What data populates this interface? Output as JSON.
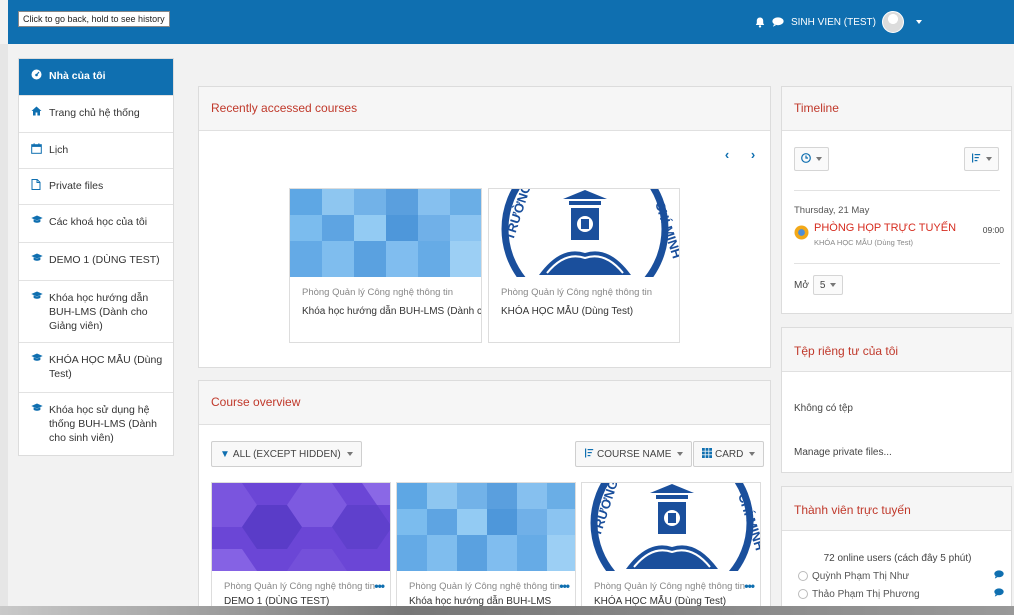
{
  "browser": {
    "tooltip": "Click to go back, hold to see history"
  },
  "navbar": {
    "user_name": "SINH VIEN (TEST)",
    "icons": [
      "bell-icon",
      "chat-icon",
      "user-avatar",
      "caret-down-icon"
    ]
  },
  "sidebar": {
    "items": [
      {
        "label": "Nhà của tôi",
        "icon": "dashboard-icon",
        "active": true
      },
      {
        "label": "Trang chủ hệ thống",
        "icon": "home-icon"
      },
      {
        "label": "Lịch",
        "icon": "calendar-icon"
      },
      {
        "label": "Private files",
        "icon": "file-icon"
      },
      {
        "label": "Các khoá học của tôi",
        "icon": "graduation-cap-icon"
      },
      {
        "label": "DEMO 1 (DÙNG TEST)",
        "icon": "graduation-cap-icon"
      },
      {
        "label": "Khóa học hướng dẫn BUH-LMS (Dành cho Giảng viên)",
        "icon": "graduation-cap-icon"
      },
      {
        "label": "KHÓA HỌC MẪU (Dùng Test)",
        "icon": "graduation-cap-icon"
      },
      {
        "label": "Khóa học sử dụng hệ thống BUH-LMS (Dành cho sinh viên)",
        "icon": "graduation-cap-icon"
      }
    ]
  },
  "recent": {
    "title": "Recently accessed courses",
    "prev": "‹",
    "next": "›",
    "courses": [
      {
        "category": "Phòng Quản lý Công nghệ thông tin",
        "name": "Khóa học hướng dẫn BUH-LMS (Dành cho Giảng viên)"
      },
      {
        "category": "Phòng Quản lý Công nghệ thông tin",
        "name": "KHÓA HỌC MẪU (Dùng Test)"
      }
    ]
  },
  "overview": {
    "title": "Course overview",
    "filter": "ALL (EXCEPT HIDDEN)",
    "sort": "COURSE NAME",
    "view": "CARD",
    "more": "•••",
    "courses": [
      {
        "category": "Phòng Quản lý Công nghệ thông tin",
        "name": "DEMO 1 (DÙNG TEST)"
      },
      {
        "category": "Phòng Quản lý Công nghệ thông tin",
        "name": "Khóa học hướng dẫn BUH-LMS"
      },
      {
        "category": "Phòng Quản lý Công nghệ thông tin",
        "name": "KHÓA HỌC MẪU (Dùng Test)"
      }
    ]
  },
  "timeline": {
    "title": "Timeline",
    "date": "Thursday, 21 May",
    "event_title": "PHÒNG HỌP TRỰC TUYẾN",
    "event_course": "KHÓA HỌC MẪU (Dùng Test)",
    "event_time": "09:00",
    "more_label": "Mở",
    "more_count": "5"
  },
  "private_files": {
    "title": "Tệp riêng tư của tôi",
    "empty": "Không có tệp",
    "manage": "Manage private files..."
  },
  "online": {
    "title": "Thành viên trực tuyến",
    "summary": "72 online users (cách đây 5 phút)",
    "users": [
      "Quỳnh Phạm Thị Như",
      "Thảo Phạm Thị Phương"
    ]
  },
  "colors": {
    "brand": "#0f6fb0",
    "heading": "#c0392b",
    "event": "#d62c1f"
  }
}
